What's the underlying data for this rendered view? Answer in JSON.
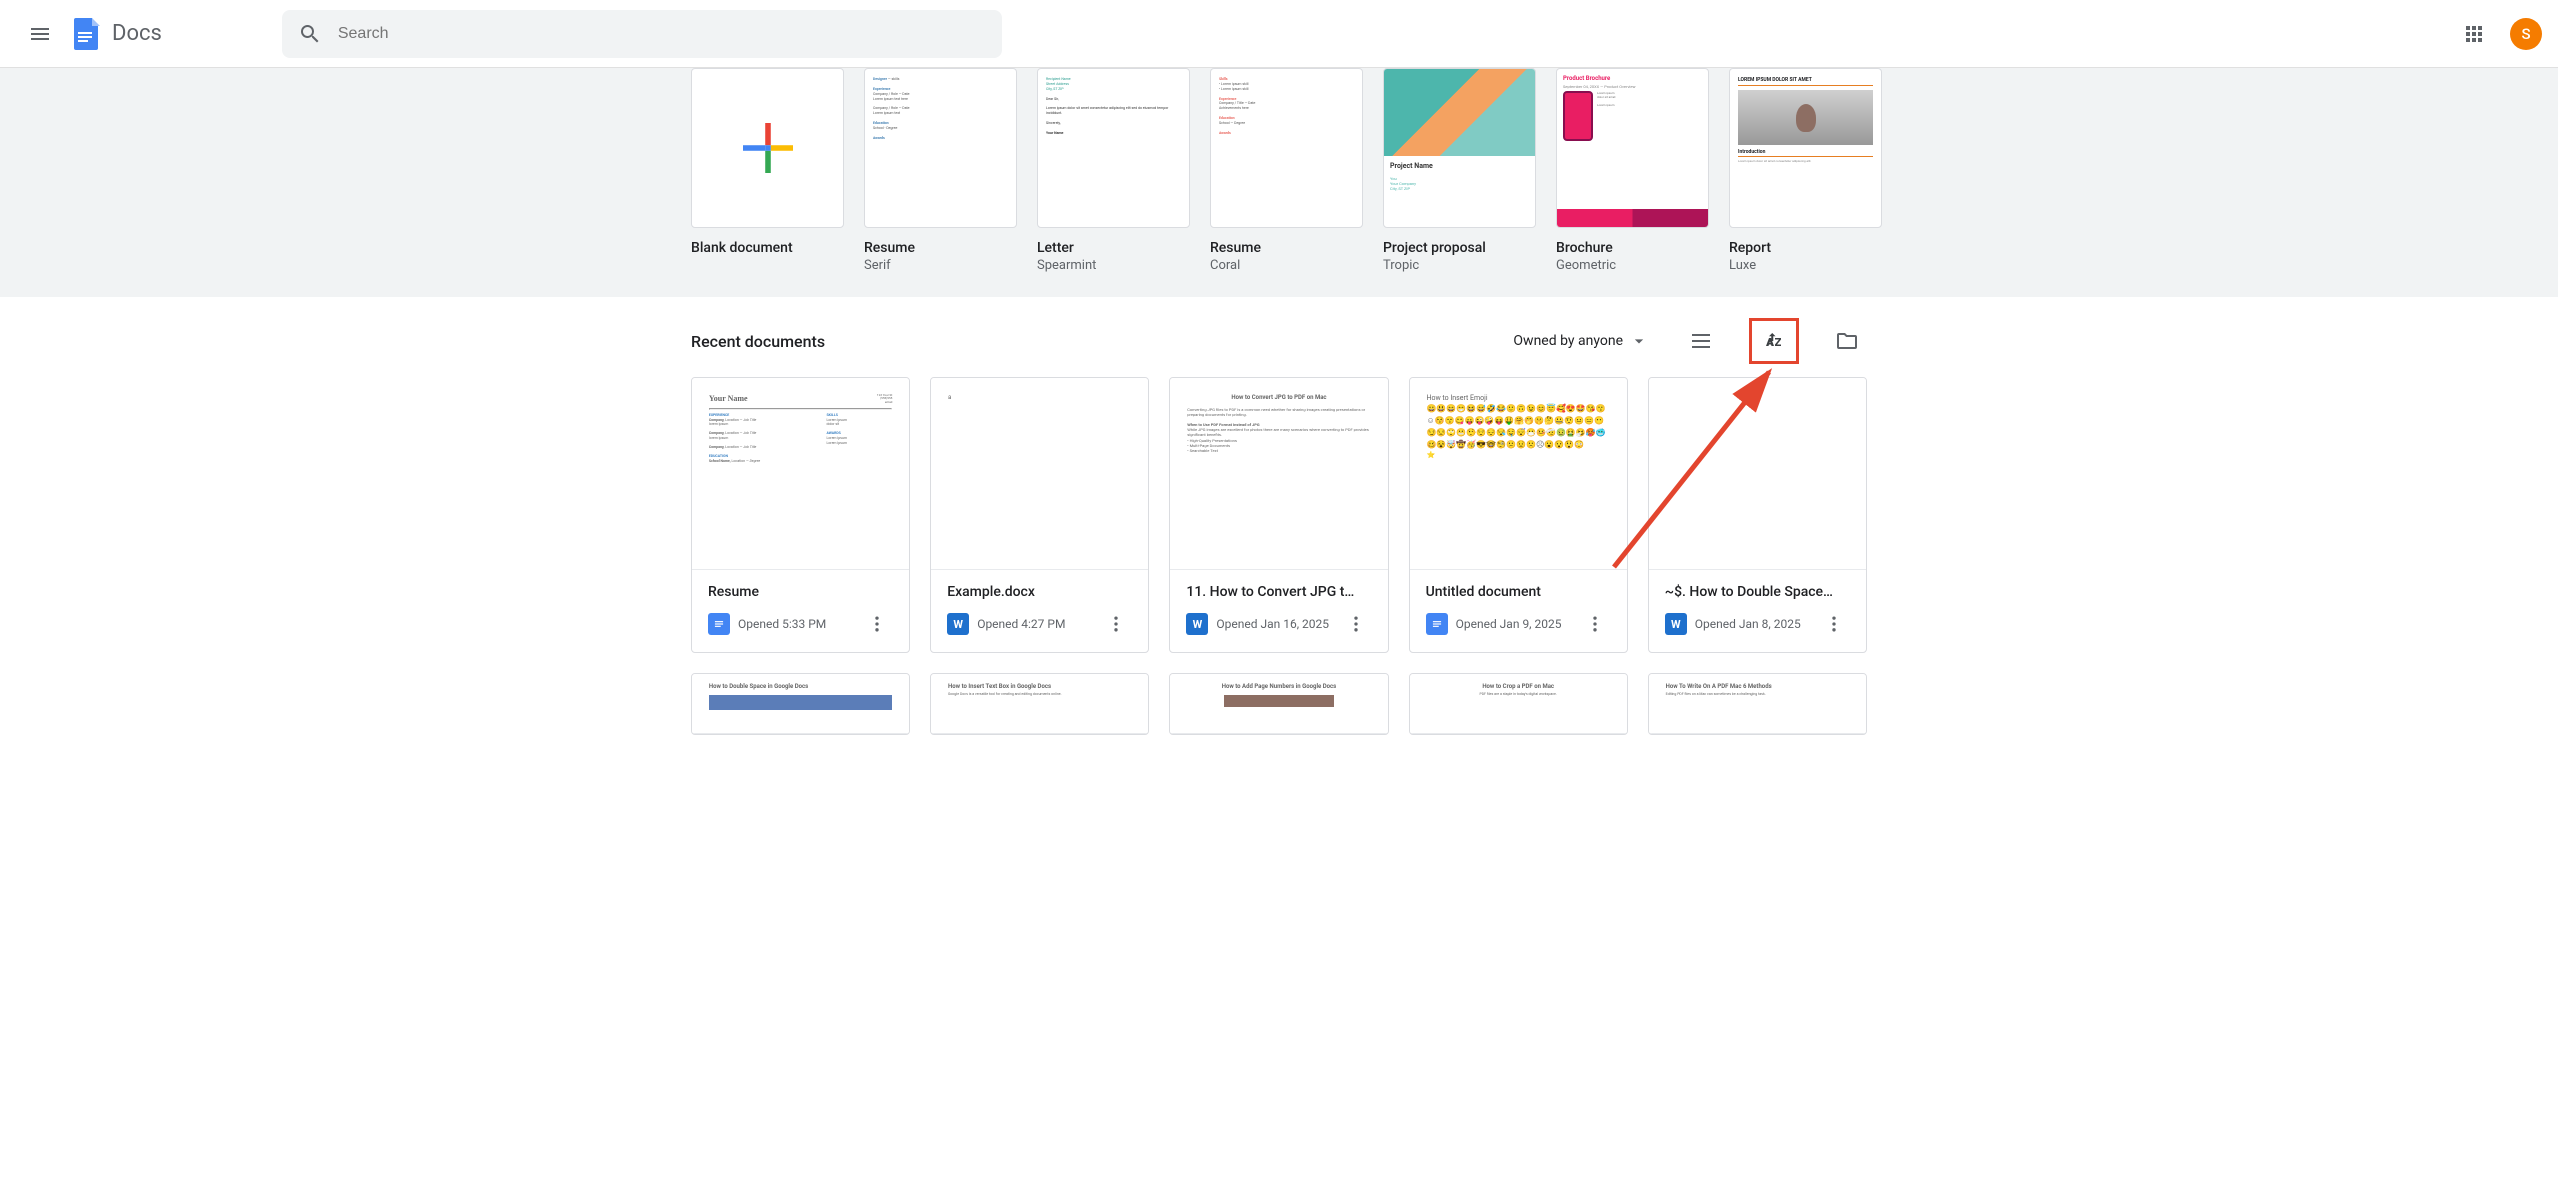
{
  "header": {
    "app_name": "Docs",
    "search_placeholder": "Search",
    "avatar_initial": "S"
  },
  "templates": [
    {
      "title": "Blank document",
      "subtitle": ""
    },
    {
      "title": "Resume",
      "subtitle": "Serif"
    },
    {
      "title": "Letter",
      "subtitle": "Spearmint"
    },
    {
      "title": "Resume",
      "subtitle": "Coral"
    },
    {
      "title": "Project proposal",
      "subtitle": "Tropic"
    },
    {
      "title": "Brochure",
      "subtitle": "Geometric"
    },
    {
      "title": "Report",
      "subtitle": "Luxe"
    }
  ],
  "recent": {
    "heading": "Recent documents",
    "owned_label": "Owned by anyone"
  },
  "documents_row1": [
    {
      "title": "Resume",
      "opened": "Opened 5:33 PM",
      "type": "docs"
    },
    {
      "title": "Example.docx",
      "opened": "Opened 4:27 PM",
      "type": "word"
    },
    {
      "title": "11. How to Convert JPG t…",
      "opened": "Opened Jan 16, 2025",
      "type": "word"
    },
    {
      "title": "Untitled document",
      "opened": "Opened Jan 9, 2025",
      "type": "docs"
    },
    {
      "title": "~$. How to Double Space…",
      "opened": "Opened Jan 8, 2025",
      "type": "word"
    }
  ],
  "documents_row2": [
    {
      "preview_title": "How to Double Space in Google Docs"
    },
    {
      "preview_title": "How to Insert Text Box in Google Docs"
    },
    {
      "preview_title": "How to Add Page Numbers in Google Docs"
    },
    {
      "preview_title": "How to Crop a PDF on Mac"
    },
    {
      "preview_title": "How To Write On A PDF Mac 6 Methods"
    }
  ],
  "thumb_previews": {
    "resume": "Your Name",
    "convert": "How to Convert JPG to PDF on Mac",
    "emoji": "How to Insert Emoji",
    "brochure_title": "Product Brochure",
    "proposal_title": "Project Name",
    "report_title": "LOREM IPSUM DOLOR SIT AMET",
    "report_intro": "Introduction"
  }
}
